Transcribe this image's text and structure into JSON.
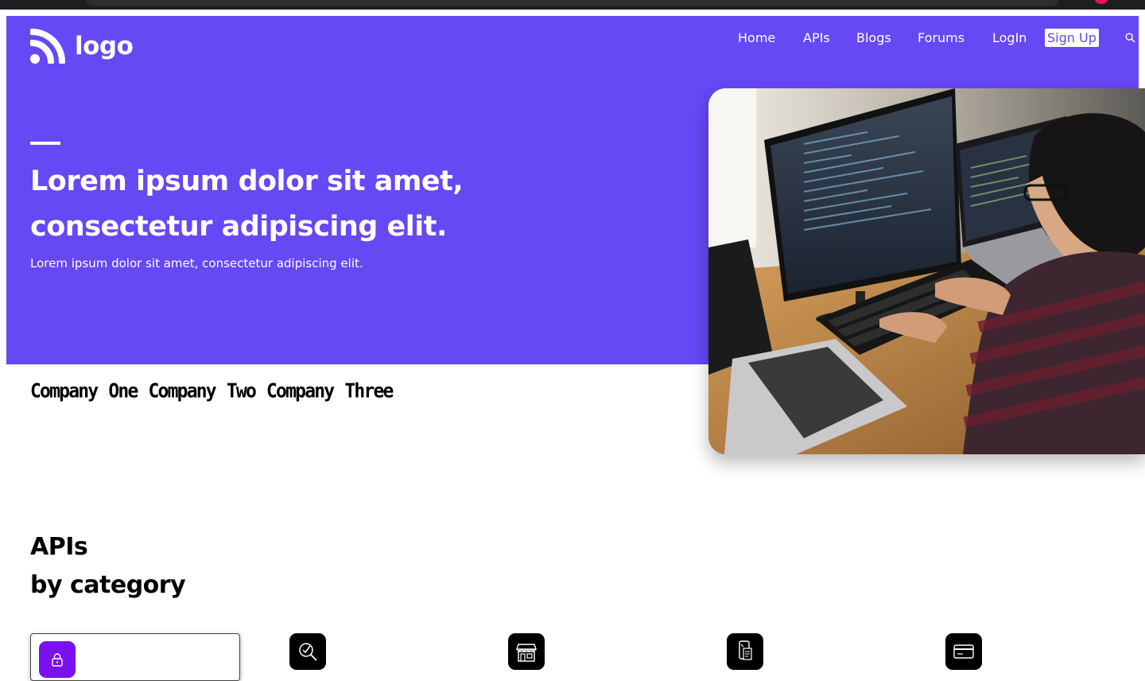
{
  "colors": {
    "brand": "#6648F5",
    "white": "#FFFFFF",
    "accent_dot": "#E8155E",
    "category_active": "#7B10F0",
    "category_default": "#000000"
  },
  "header": {
    "logo_text": "logo",
    "logo_icon": "rss-icon",
    "nav": [
      {
        "label": "Home"
      },
      {
        "label": "APIs"
      },
      {
        "label": "Blogs"
      },
      {
        "label": "Forums"
      },
      {
        "label": "LogIn"
      }
    ],
    "signup_label": "Sign Up",
    "search_icon": "search-icon"
  },
  "hero": {
    "title": "Lorem ipsum dolor sit amet, consectetur adipiscing elit.",
    "subtitle": "Lorem ipsum dolor sit amet, consectetur adipiscing elit."
  },
  "companies": [
    "Company",
    "One",
    "Company",
    "Two",
    "Company",
    "Three"
  ],
  "apis": {
    "heading_line1": "APIs",
    "heading_line2": "by category",
    "categories": [
      {
        "icon": "lock-icon",
        "active": true
      },
      {
        "icon": "search-check-icon",
        "active": false
      },
      {
        "icon": "storefront-icon",
        "active": false
      },
      {
        "icon": "mobile-document-icon",
        "active": false
      },
      {
        "icon": "credit-card-icon",
        "active": false
      }
    ]
  }
}
